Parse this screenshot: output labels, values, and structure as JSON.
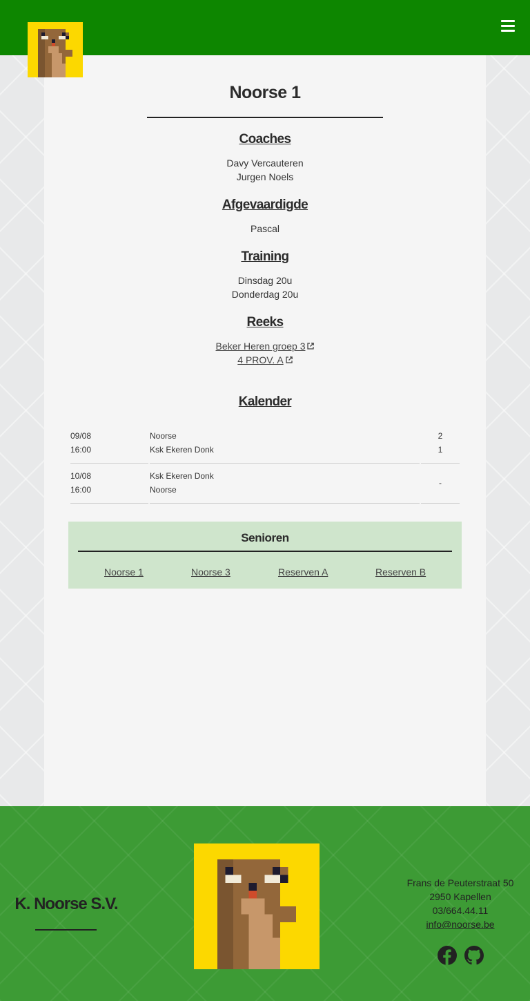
{
  "header": {
    "menu_icon": "hamburger-menu-icon"
  },
  "team": {
    "title": "Noorse 1",
    "sections": {
      "coaches": {
        "heading": "Coaches",
        "items": [
          "Davy Vercauteren",
          "Jurgen Noels"
        ]
      },
      "afgevaardigde": {
        "heading": "Afgevaardigde",
        "items": [
          "Pascal"
        ]
      },
      "training": {
        "heading": "Training",
        "items": [
          "Dinsdag 20u",
          "Donderdag 20u"
        ]
      },
      "reeks": {
        "heading": "Reeks",
        "items": [
          "Beker Heren groep 3",
          "4 PROV. A"
        ],
        "link_icon": "external-link-icon"
      }
    }
  },
  "kalender": {
    "heading": "Kalender",
    "matches": [
      {
        "date": "09/08",
        "time": "16:00",
        "home": "Noorse",
        "away": "Ksk Ekeren Donk",
        "score_home": "2",
        "score_away": "1"
      },
      {
        "date": "10/08",
        "time": "16:00",
        "home": "Ksk Ekeren Donk",
        "away": "Noorse",
        "score": "-"
      }
    ]
  },
  "senioren": {
    "title": "Senioren",
    "links": [
      "Noorse 1",
      "Noorse 3",
      "Reserven A",
      "Reserven B"
    ]
  },
  "footer": {
    "club_name": "K. Noorse S.V.",
    "address": [
      "Frans de Peuterstraat 50",
      "2950 Kapellen",
      "03/664.44.11"
    ],
    "email": "info@noorse.be",
    "social_icons": [
      "facebook-icon",
      "github-icon"
    ]
  },
  "colors": {
    "header_green": "#0d8600",
    "footer_green": "#3d9b35",
    "senioren_bg": "#cfe5cc",
    "logo_yellow": "#fcd800"
  }
}
